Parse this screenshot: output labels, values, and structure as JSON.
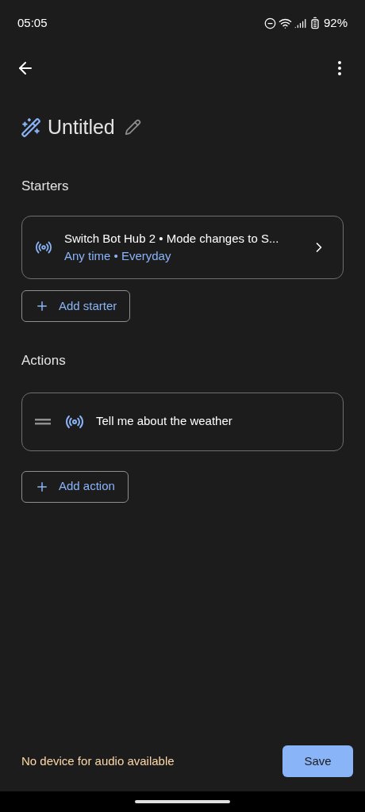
{
  "status_bar": {
    "time": "05:05",
    "battery": "92%"
  },
  "title": "Untitled",
  "starters": {
    "heading": "Starters",
    "items": [
      {
        "title": "Switch Bot Hub 2 • Mode changes to S...",
        "subtitle": "Any time • Everyday"
      }
    ],
    "add_label": "Add starter"
  },
  "actions": {
    "heading": "Actions",
    "items": [
      {
        "title": "Tell me about the weather"
      }
    ],
    "add_label": "Add action"
  },
  "footer": {
    "message": "No device for audio available",
    "save_label": "Save"
  }
}
